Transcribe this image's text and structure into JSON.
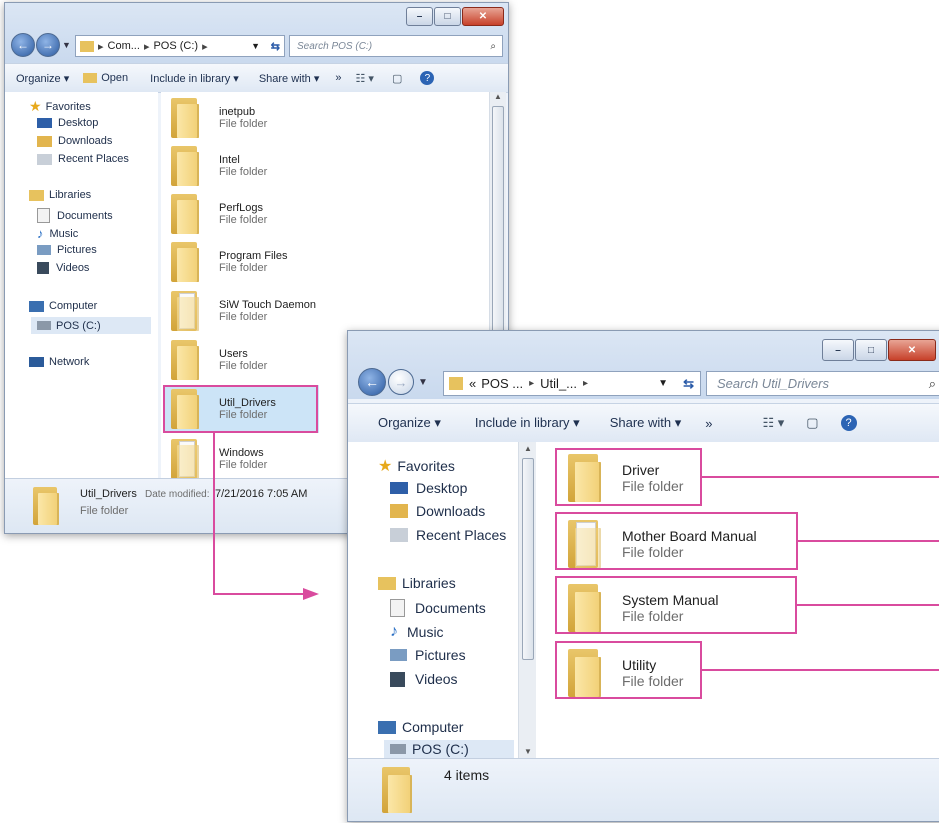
{
  "back_window": {
    "controls": {
      "minimize": "–",
      "maximize": "□",
      "close": "✕"
    },
    "nav": {
      "back": "←",
      "forward": "→"
    },
    "address": {
      "segments": [
        "Com...",
        "POS (C:)"
      ]
    },
    "search_placeholder": "Search POS (C:)",
    "toolbar": {
      "organize": "Organize ▾",
      "open": "Open",
      "include": "Include in library ▾",
      "share": "Share with ▾",
      "more": "»"
    },
    "nav_pane": {
      "favorites": "Favorites",
      "favorites_items": [
        "Desktop",
        "Downloads",
        "Recent Places"
      ],
      "libraries": "Libraries",
      "libraries_items": [
        "Documents",
        "Music",
        "Pictures",
        "Videos"
      ],
      "computer": "Computer",
      "drive": "POS (C:)",
      "network": "Network"
    },
    "files": [
      {
        "name": "inetpub",
        "type": "File folder"
      },
      {
        "name": "Intel",
        "type": "File folder"
      },
      {
        "name": "PerfLogs",
        "type": "File folder"
      },
      {
        "name": "Program Files",
        "type": "File folder"
      },
      {
        "name": "SiW Touch Daemon",
        "type": "File folder"
      },
      {
        "name": "Users",
        "type": "File folder"
      },
      {
        "name": "Util_Drivers",
        "type": "File folder"
      },
      {
        "name": "Windows",
        "type": "File folder"
      }
    ],
    "details": {
      "name": "Util_Drivers",
      "date_label": "Date modified:",
      "date_value": "7/21/2016 7:05 AM",
      "type": "File folder"
    }
  },
  "front_window": {
    "controls": {
      "minimize": "–",
      "maximize": "□",
      "close": "✕"
    },
    "nav": {
      "back": "←",
      "forward": "→"
    },
    "address": {
      "prefix": "«",
      "segments": [
        "POS ...",
        "Util_..."
      ]
    },
    "search_placeholder": "Search Util_Drivers",
    "toolbar": {
      "organize": "Organize ▾",
      "include": "Include in library ▾",
      "share": "Share with ▾",
      "more": "»"
    },
    "nav_pane": {
      "favorites": "Favorites",
      "favorites_items": [
        "Desktop",
        "Downloads",
        "Recent Places"
      ],
      "libraries": "Libraries",
      "libraries_items": [
        "Documents",
        "Music",
        "Pictures",
        "Videos"
      ],
      "computer": "Computer",
      "drive": "POS (C:)"
    },
    "files": [
      {
        "name": "Driver",
        "type": "File folder"
      },
      {
        "name": "Mother Board Manual",
        "type": "File folder"
      },
      {
        "name": "System Manual",
        "type": "File folder"
      },
      {
        "name": "Utility",
        "type": "File folder"
      }
    ],
    "status": "4 items"
  },
  "colors": {
    "highlight": "#d94b9e",
    "selection": "#cce4f7",
    "window_frame": "#dbe6f4",
    "toolbar": "#e6eef8"
  }
}
